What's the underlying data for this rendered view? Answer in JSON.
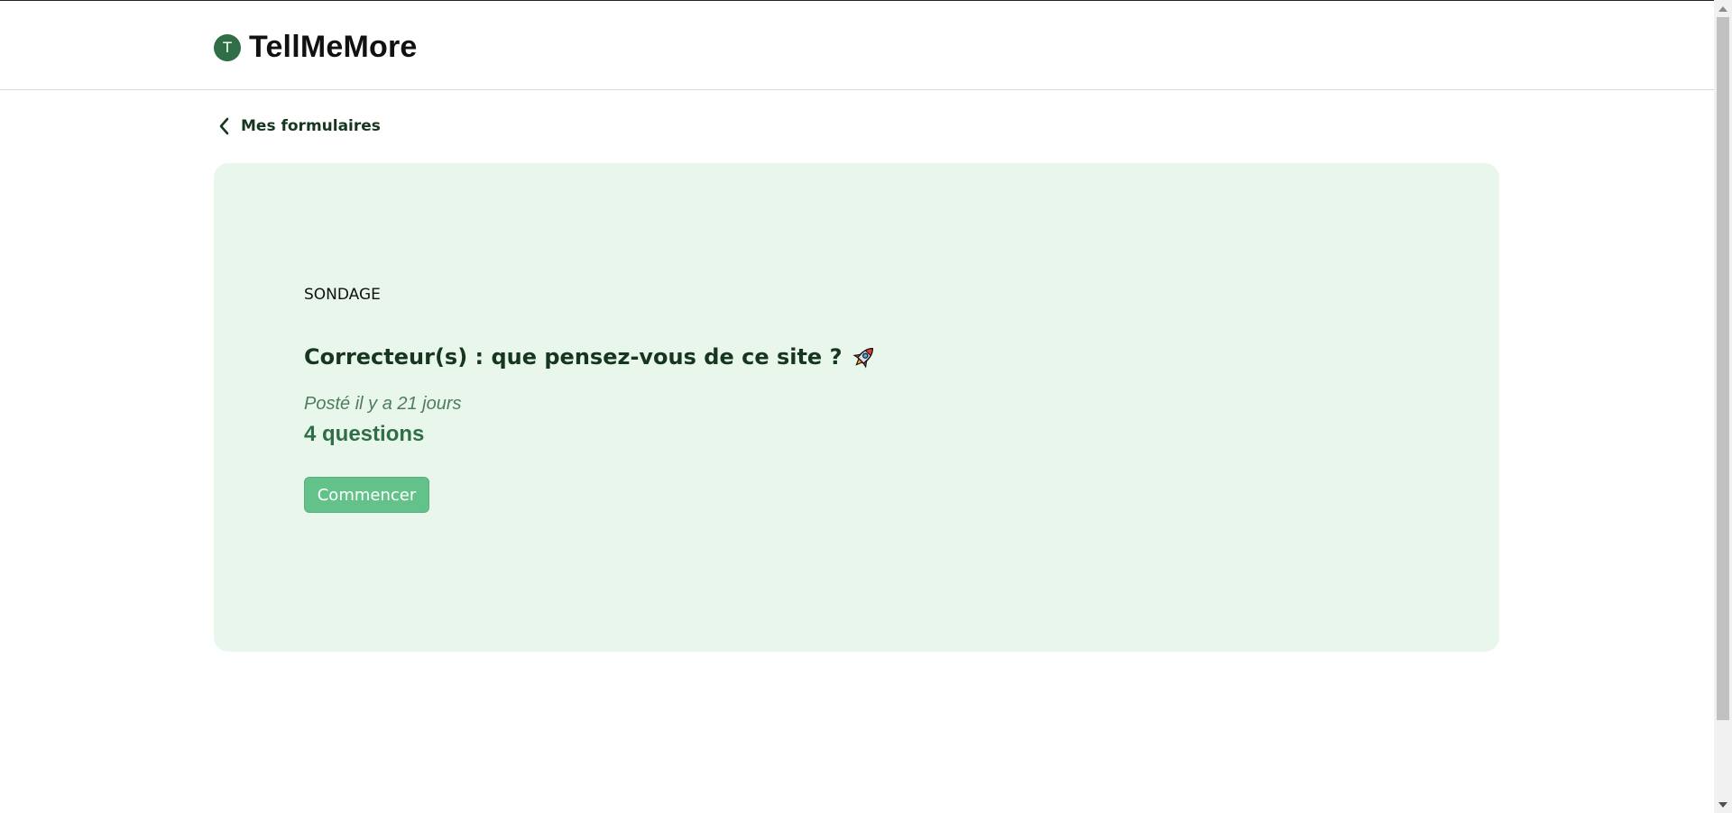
{
  "header": {
    "logo_letter": "T",
    "brand": "TellMeMore"
  },
  "nav": {
    "back_label": "Mes formulaires"
  },
  "form": {
    "category": "SONDAGE",
    "title": "Correcteur(s) : que pensez-vous de ce site ?",
    "title_icon": "rocket-icon",
    "posted": "Posté il y a 21 jours",
    "question_count": "4 questions",
    "start_label": "Commencer"
  },
  "colors": {
    "brand_green": "#2f6e46",
    "card_background": "#e9f6ec",
    "button_green": "#63c28a",
    "title_text": "#17361f"
  }
}
